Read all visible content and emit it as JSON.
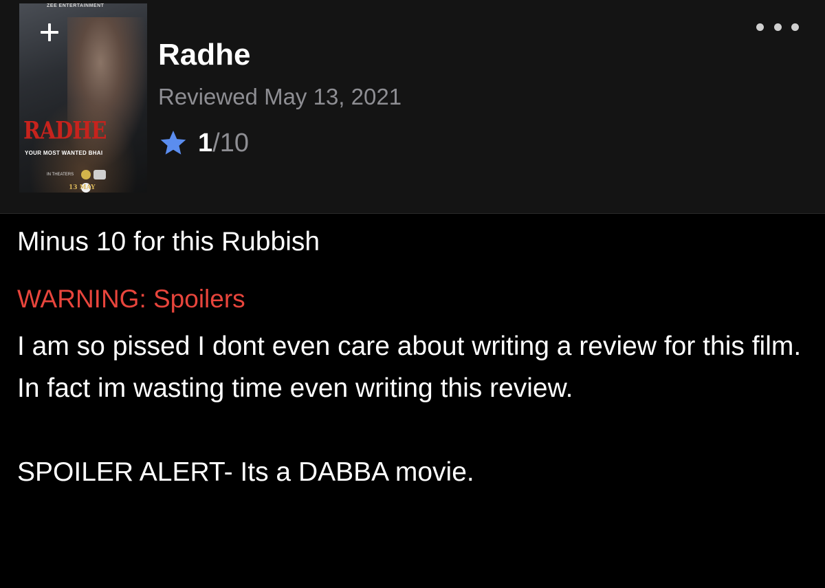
{
  "header": {
    "poster": {
      "top_text": "ZEE ENTERTAINMENT",
      "title_text": "RADHE",
      "subtitle_text": "YOUR MOST WANTED BHAI",
      "theaters_text": "IN THEATERS",
      "date_text": "13 MAY"
    },
    "add_icon": "plus-icon",
    "more_icon": "ellipsis-icon",
    "movie_title": "Radhe",
    "review_date": "Reviewed May 13, 2021",
    "rating": {
      "icon": "star-icon",
      "value": "1",
      "max": "/10",
      "star_color": "#5b8def"
    }
  },
  "review": {
    "heading": "Minus 10 for this Rubbish",
    "warning": "WARNING: Spoilers",
    "warning_color": "#e8453c",
    "paragraphs": [
      "I am so pissed I dont even care about writing a review for this film. In fact im wasting time even writing this review.",
      "SPOILER ALERT- Its a DABBA movie."
    ]
  }
}
